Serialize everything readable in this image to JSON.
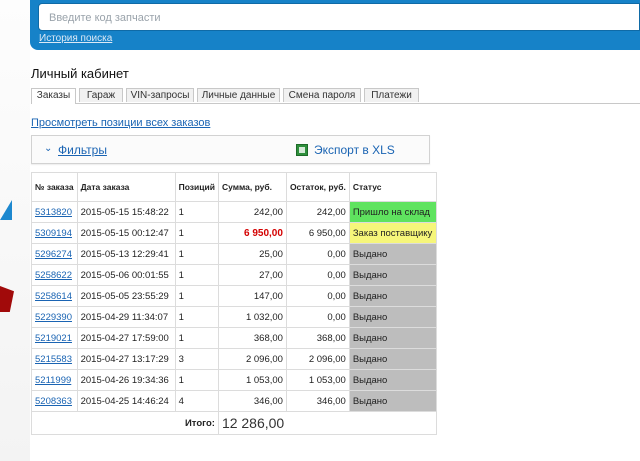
{
  "search": {
    "placeholder": "Введите код запчасти",
    "history_link": "История поиска"
  },
  "page": {
    "title": "Личный кабинет"
  },
  "tabs": [
    {
      "label": "Заказы",
      "active": true
    },
    {
      "label": "Гараж",
      "active": false
    },
    {
      "label": "VIN-запросы",
      "active": false
    },
    {
      "label": "Личные данные",
      "active": false
    },
    {
      "label": "Смена пароля",
      "active": false
    },
    {
      "label": "Платежи",
      "active": false
    }
  ],
  "view_all_link": "Просмотреть позиции всех заказов",
  "filters": {
    "label": "Фильтры",
    "export_label": "Экспорт в XLS"
  },
  "orders_table": {
    "headers": [
      "№ заказа",
      "Дата заказа",
      "Позиций",
      "Сумма, руб.",
      "Остаток, руб.",
      "Статус"
    ],
    "rows": [
      {
        "number": "5313820",
        "date": "2015-05-15 15:48:22",
        "positions": "1",
        "sum": "242,00",
        "rest": "242,00",
        "status": "Пришло на склад",
        "status_color": "#5fe35f",
        "sum_highlight": false
      },
      {
        "number": "5309194",
        "date": "2015-05-15 00:12:47",
        "positions": "1",
        "sum": "6 950,00",
        "rest": "6 950,00",
        "status": "Заказ поставщику",
        "status_color": "#f6f67a",
        "sum_highlight": true
      },
      {
        "number": "5296274",
        "date": "2015-05-13 12:29:41",
        "positions": "1",
        "sum": "25,00",
        "rest": "0,00",
        "status": "Выдано",
        "status_color": "#bdbdbd",
        "sum_highlight": false
      },
      {
        "number": "5258622",
        "date": "2015-05-06 00:01:55",
        "positions": "1",
        "sum": "27,00",
        "rest": "0,00",
        "status": "Выдано",
        "status_color": "#bdbdbd",
        "sum_highlight": false
      },
      {
        "number": "5258614",
        "date": "2015-05-05 23:55:29",
        "positions": "1",
        "sum": "147,00",
        "rest": "0,00",
        "status": "Выдано",
        "status_color": "#bdbdbd",
        "sum_highlight": false
      },
      {
        "number": "5229390",
        "date": "2015-04-29 11:34:07",
        "positions": "1",
        "sum": "1 032,00",
        "rest": "0,00",
        "status": "Выдано",
        "status_color": "#bdbdbd",
        "sum_highlight": false
      },
      {
        "number": "5219021",
        "date": "2015-04-27 17:59:00",
        "positions": "1",
        "sum": "368,00",
        "rest": "368,00",
        "status": "Выдано",
        "status_color": "#bdbdbd",
        "sum_highlight": false
      },
      {
        "number": "5215583",
        "date": "2015-04-27 13:17:29",
        "positions": "3",
        "sum": "2 096,00",
        "rest": "2 096,00",
        "status": "Выдано",
        "status_color": "#bdbdbd",
        "sum_highlight": false
      },
      {
        "number": "5211999",
        "date": "2015-04-26 19:34:36",
        "positions": "1",
        "sum": "1 053,00",
        "rest": "1 053,00",
        "status": "Выдано",
        "status_color": "#bdbdbd",
        "sum_highlight": false
      },
      {
        "number": "5208363",
        "date": "2015-04-25 14:46:24",
        "positions": "4",
        "sum": "346,00",
        "rest": "346,00",
        "status": "Выдано",
        "status_color": "#bdbdbd",
        "sum_highlight": false
      }
    ],
    "total_label": "Итого:",
    "total_value": "12 286,00"
  },
  "colors": {
    "brand_blue": "#1682c8",
    "link": "#1a64b3",
    "sum_highlight": "#d40000"
  }
}
